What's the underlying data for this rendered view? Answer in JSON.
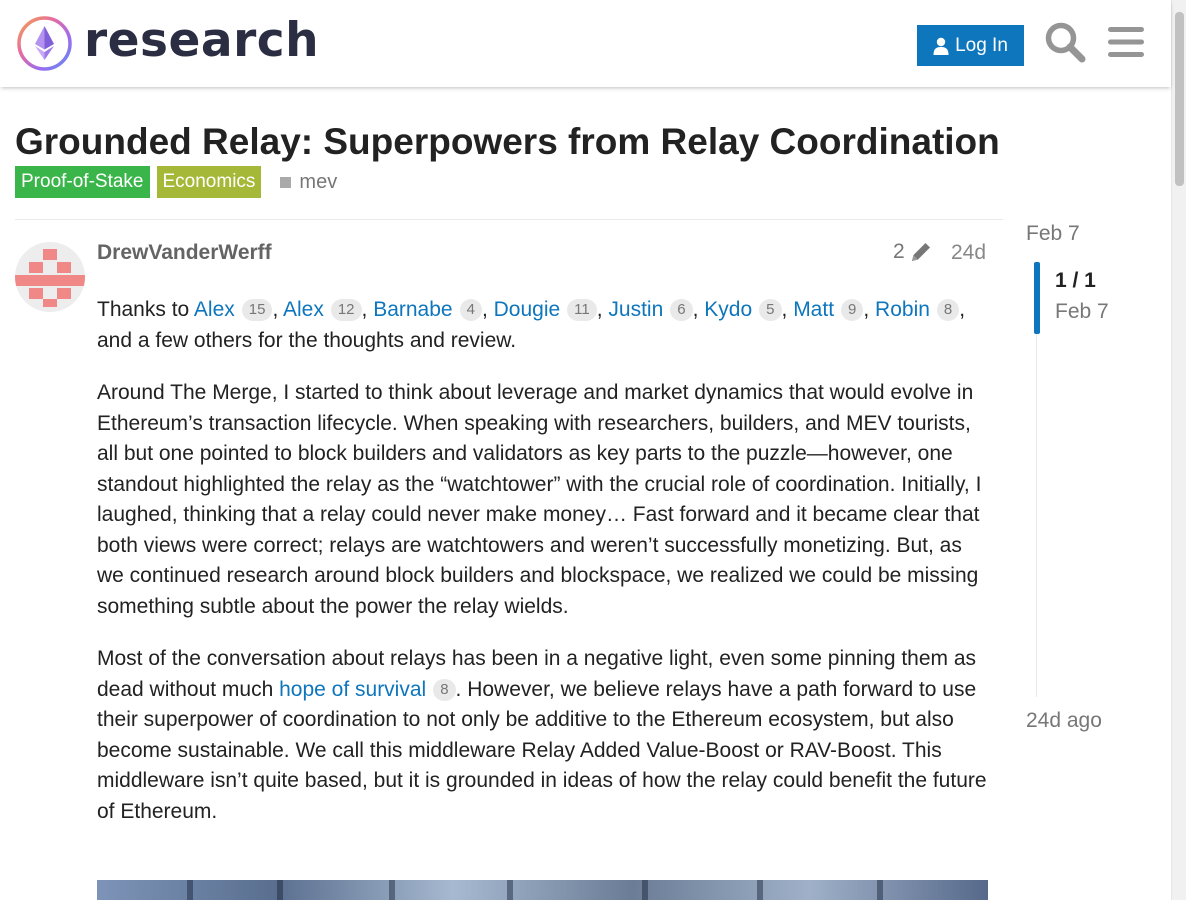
{
  "header": {
    "site_name": "research",
    "login_label": "Log In",
    "icons": [
      "logo-icon",
      "user-icon",
      "search-icon",
      "hamburger-menu-icon"
    ]
  },
  "topic": {
    "title": "Grounded Relay: Superpowers from Relay Coordination",
    "categories": [
      {
        "label": "Proof-of-Stake",
        "color": "#3ab54a"
      },
      {
        "label": "Economics",
        "color": "#a6b837"
      }
    ],
    "tags": [
      "mev"
    ]
  },
  "post": {
    "author": "DrewVanderWerff",
    "edit_count": "2",
    "age": "24d",
    "thanks": {
      "prefix": "Thanks to",
      "people": [
        {
          "name": "Alex",
          "count": "15"
        },
        {
          "name": "Alex",
          "count": "12"
        },
        {
          "name": "Barnabe",
          "count": "4"
        },
        {
          "name": "Dougie",
          "count": "11"
        },
        {
          "name": "Justin",
          "count": "6"
        },
        {
          "name": "Kydo",
          "count": "5"
        },
        {
          "name": "Matt",
          "count": "9"
        },
        {
          "name": "Robin",
          "count": "8"
        }
      ],
      "suffix": ", and a few others for the thoughts and review."
    },
    "paragraph1": "Around The Merge, I started to think about leverage and market dynamics that would evolve in Ethereum’s transaction lifecycle. When speaking with researchers, builders, and MEV tourists, all but one pointed to block builders and validators as key parts to the puzzle—however, one standout highlighted the relay as the “watchtower” with the crucial role of coordination. Initially, I laughed, thinking that a relay could never make money… Fast forward and it became clear that both views were correct; relays are watchtowers and weren’t successfully monetizing. But, as we continued research around block builders and blockspace, we realized we could be missing something subtle about the power the relay wields.",
    "paragraph2": {
      "before": "Most of the conversation about relays has been in a negative light, even some pinning them as dead without much ",
      "link": "hope of survival",
      "link_count": "8",
      "after": ". However, we believe relays have a path forward to use their superpower of coordination to not only be additive to the Ethereum ecosystem, but also become sustainable. We call this middleware Relay Added Value-Boost or RAV-Boost. This middleware isn’t quite based, but it is grounded in ideas of how the relay could benefit the future of Ethereum."
    }
  },
  "timeline": {
    "start_date": "Feb 7",
    "position": "1 / 1",
    "current_date": "Feb 7",
    "end_label": "24d ago"
  },
  "colors": {
    "accent": "#0e76bd",
    "proof_of_stake": "#3ab54a",
    "economics": "#a6b837"
  }
}
